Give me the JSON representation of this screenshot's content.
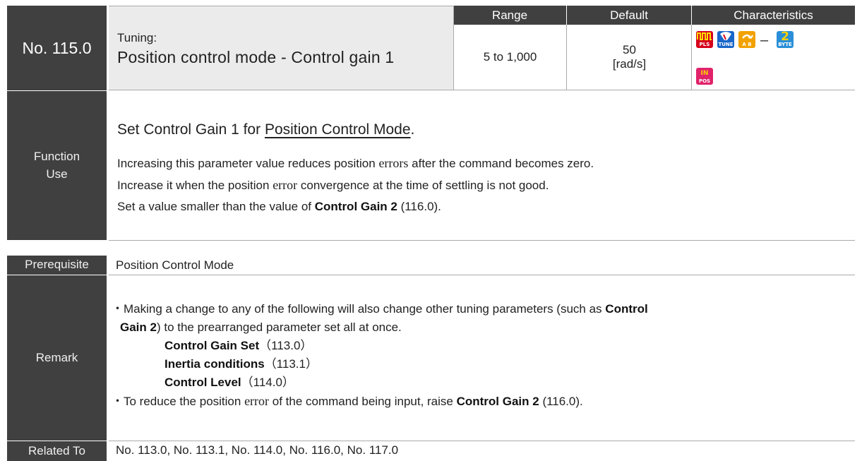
{
  "header": {
    "param_no": "No. 115.0",
    "title_label": "Tuning:",
    "title": "Position control mode - Control gain 1",
    "columns": [
      "Range",
      "Default",
      "Characteristics"
    ],
    "range": "5 to 1,000",
    "default_value": "50",
    "default_unit": "[rad/s]",
    "characteristics": {
      "icons": [
        {
          "name": "pulse-pls-icon",
          "text": "PLS",
          "color": "#d6001c"
        },
        {
          "name": "tune-icon",
          "text": "TUNE",
          "color": "#1a66c9"
        },
        {
          "name": "ab-icon",
          "text": "A B",
          "color": "#f2a200"
        },
        {
          "name": "2byte-icon",
          "text": "2",
          "sub": "BYTE",
          "color": "#2a8fd8"
        },
        {
          "name": "inpos-icon",
          "text": "IN",
          "sub": "POS",
          "color": "#e0236b"
        }
      ],
      "dash": "–"
    }
  },
  "function_use": {
    "label": [
      "Function",
      "Use"
    ],
    "heading_pre": "Set Control Gain 1 for ",
    "heading_link": "Position Control Mode",
    "heading_post": ".",
    "line1_a": "Increasing this parameter value reduces position ",
    "line1_b": "errors",
    "line1_c": " after the command becomes zero.",
    "line2_a": "Increase it when the position ",
    "line2_b": "error",
    "line2_c": " convergence at the time of settling is not good.",
    "line3_a": "Set a value smaller than the value of ",
    "line3_b": "Control Gain 2",
    "line3_c": " (116.0)."
  },
  "prerequisite": {
    "label": "Prerequisite",
    "text": "Position Control Mode"
  },
  "remark": {
    "label": "Remark",
    "b1_a": "・Making a change to any of the following will also change other tuning parameters (such as ",
    "b1_b": "Control",
    "b1_c": "Gain 2",
    "b1_d": ") to the prearranged parameter set all at once.",
    "items": [
      {
        "name": "Control Gain Set",
        "code": "（113.0）"
      },
      {
        "name": "Inertia conditions",
        "code": "（113.1）"
      },
      {
        "name": "Control Level",
        "code": "（114.0）"
      }
    ],
    "b2_a": "・To reduce the position ",
    "b2_b": "error",
    "b2_c": " of the command being input, raise ",
    "b2_d": "Control Gain 2",
    "b2_e": " (116.0)."
  },
  "related": {
    "label": "Related To",
    "text": "No. 113.0, No. 113.1, No. 114.0, No. 116.0, No. 117.0"
  }
}
